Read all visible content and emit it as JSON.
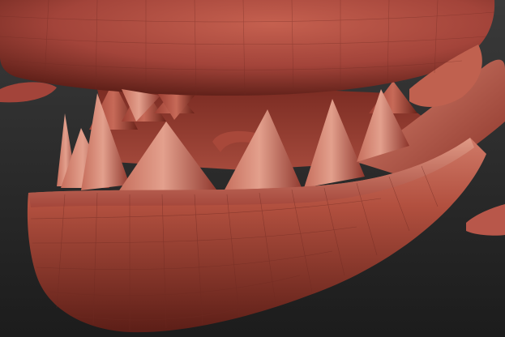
{
  "viewport": {
    "background_top": "#3a3a3a",
    "background_bottom": "#1c1c1c"
  },
  "model": {
    "subject": "3d-sculpt-creature-jaw",
    "material_color": "#a3443a",
    "highlight_color": "#d98572",
    "shadow_color": "#4a1712",
    "wire_color": "#6e2a22"
  }
}
